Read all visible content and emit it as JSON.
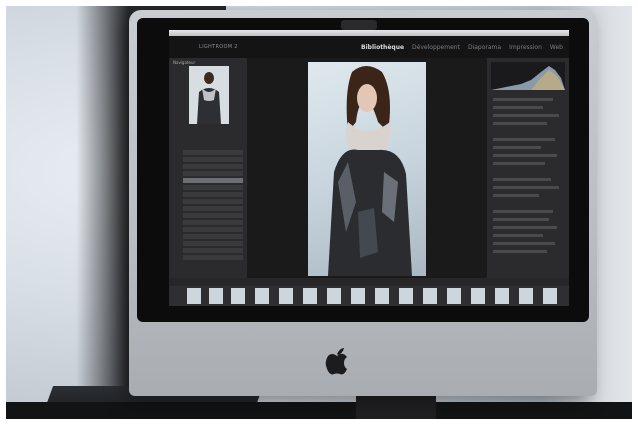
{
  "scene": {
    "description_kind": "photo of an iMac running Lightroom 2",
    "accent_colors": {
      "bezel": "#0c0c0d",
      "aluminum": "#c0c4c9",
      "ui_dark": "#1d1d1f"
    }
  },
  "app": {
    "name": "LIGHTROOM 2",
    "modules": [
      "Bibliothèque",
      "Développement",
      "Diaporama",
      "Impression",
      "Web"
    ],
    "active_module": "Bibliothèque"
  },
  "panels": {
    "left_title": "Navigateur"
  },
  "icons": {
    "logo": "apple-logo-icon"
  }
}
